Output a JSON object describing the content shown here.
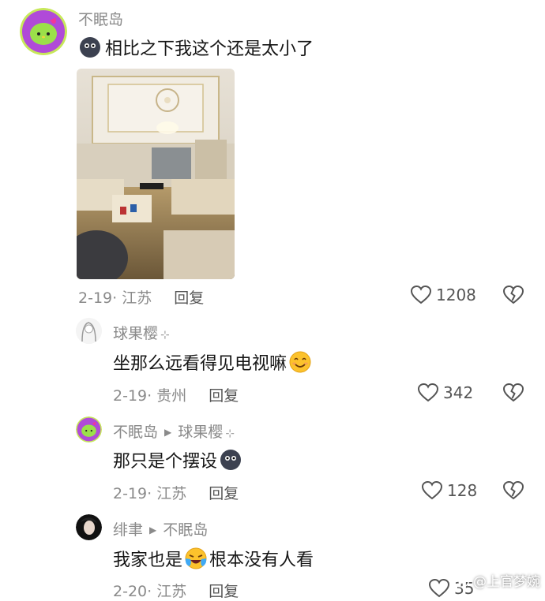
{
  "comments": [
    {
      "username": "不眠岛",
      "text": "相比之下我这个还是太小了",
      "date": "2-19",
      "location": "江苏",
      "reply_label": "回复",
      "likes": "1208"
    },
    {
      "username": "球果樱",
      "text": "坐那么远看得见电视嘛",
      "date": "2-19",
      "location": "贵州",
      "reply_label": "回复",
      "likes": "342"
    },
    {
      "username": "不眠岛",
      "reply_to": "球果樱",
      "text": "那只是个摆设",
      "date": "2-19",
      "location": "江苏",
      "reply_label": "回复",
      "likes": "128"
    },
    {
      "username": "绯聿",
      "reply_to": "不眠岛",
      "text_before": "我家也是",
      "text_after": "根本没有人看",
      "date": "2-20",
      "location": "江苏",
      "reply_label": "回复",
      "likes": "35"
    }
  ],
  "watermark": "@上官梦婉",
  "icons": {
    "like": "heart-outline-icon",
    "dislike": "broken-heart-icon",
    "emoji_face": "dark-round-face-emoji",
    "emoji_smile": "smiling-face-emoji",
    "emoji_cry": "crying-laughing-emoji"
  },
  "colors": {
    "meta_text": "#8a8a8a",
    "body_text": "#161616"
  }
}
